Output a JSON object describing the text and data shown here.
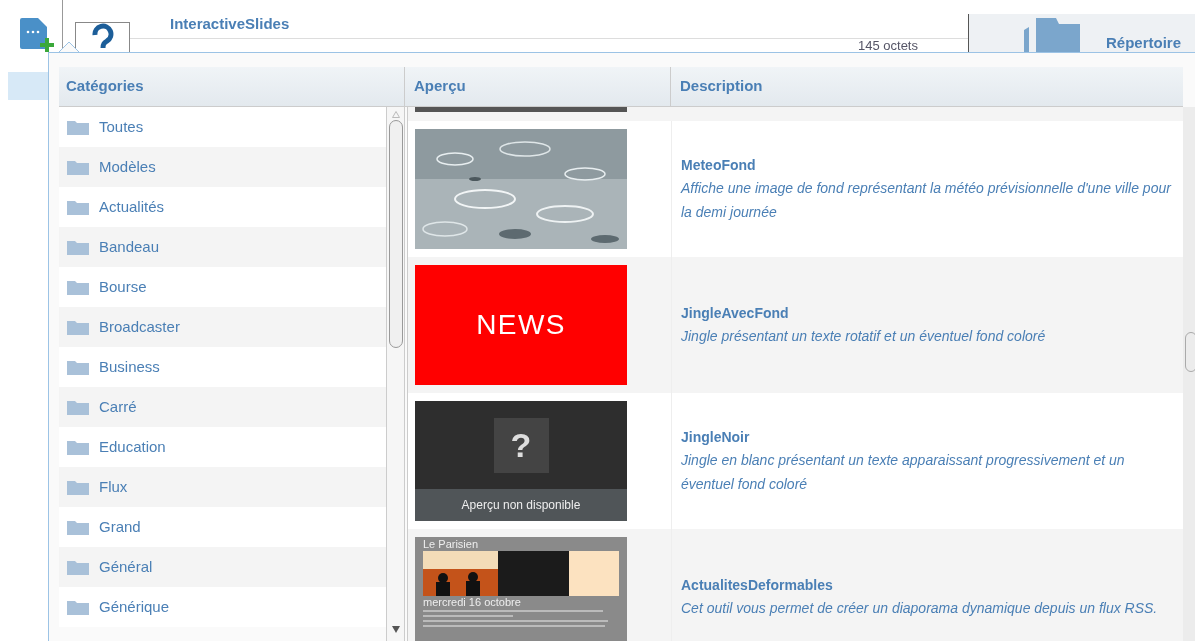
{
  "background": {
    "title": "InteractiveSlides",
    "size": "145 octets",
    "folder_label": "Répertoire"
  },
  "categories": {
    "header": "Catégories",
    "items": [
      {
        "label": "Toutes"
      },
      {
        "label": "Modèles"
      },
      {
        "label": "Actualités"
      },
      {
        "label": "Bandeau"
      },
      {
        "label": "Bourse"
      },
      {
        "label": "Broadcaster"
      },
      {
        "label": "Business"
      },
      {
        "label": "Carré"
      },
      {
        "label": "Education"
      },
      {
        "label": "Flux"
      },
      {
        "label": "Grand"
      },
      {
        "label": "Général"
      },
      {
        "label": "Générique"
      }
    ]
  },
  "table": {
    "columns": [
      "Aperçu",
      "Description"
    ],
    "rows": [
      {
        "name": "MeteoFond",
        "description": "Affiche une image de fond représentant la météo prévisionnelle d'une ville pour la demi journée"
      },
      {
        "preview": {
          "kind": "banner",
          "text": "NEWS"
        },
        "name": "JingleAvecFond",
        "description": "Jingle présentant un texte rotatif et un éventuel fond coloré"
      },
      {
        "preview": {
          "kind": "unavailable",
          "symbol": "?",
          "text": "Aperçu non disponible"
        },
        "name": "JingleNoir",
        "description": "Jingle en blanc présentant un texte apparaissant progressivement et un éventuel fond coloré"
      },
      {
        "preview": {
          "kind": "page",
          "heading": "Le Parisien",
          "date": "mercredi 16 octobre"
        },
        "name": "ActualitesDeformables",
        "description": "Cet outil vous permet de créer un diaporama dynamique depuis un flux RSS."
      }
    ]
  }
}
